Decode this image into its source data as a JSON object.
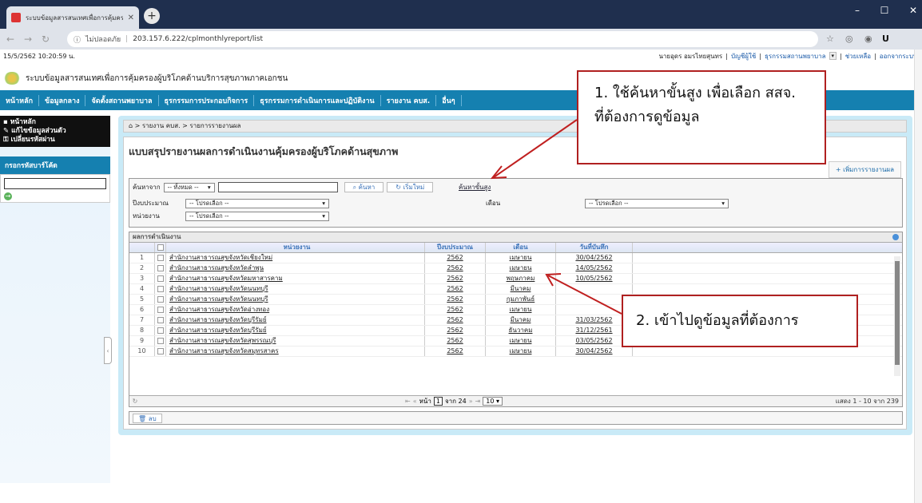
{
  "browser": {
    "tab_title": "ระบบข้อมูลสารสนเทศเพื่อการคุ้มครอง",
    "url_security": "ไม่ปลอดภัย",
    "url_host": "203.157.6.222",
    "url_path": "/cplmonthlyreport/list"
  },
  "header": {
    "datetime": "15/5/2562 10:20:59 น.",
    "user_name": "นายอุดร อมรไทยสุนทร",
    "account_link": "บัญชีผู้ใช้",
    "role_label": "ธุรกรรมสถานพยาบาล",
    "help": "ช่วยเหลือ",
    "logout": "ออกจากระบบ",
    "brand": "ระบบข้อมูลสารสนเทศเพื่อการคุ้มครองผู้บริโภคด้านบริการสุขภาพภาคเอกชน"
  },
  "menu": [
    "หน้าหลัก",
    "ข้อมูลกลาง",
    "จัดตั้งสถานพยาบาล",
    "ธุรกรรมการประกอบกิจการ",
    "ธุรกรรมการดำเนินการและปฏิบัติงาน",
    "รายงาน คบส.",
    "อื่นๆ"
  ],
  "sidebar": {
    "items": [
      "หน้าหลัก",
      "แก้ไขข้อมูลส่วนตัว",
      "เปลี่ยนรหัสผ่าน"
    ],
    "code_title": "กรอกรหัสบาร์โค้ด"
  },
  "breadcrumb": "รายงาน คบส. > รายการรายงานผล",
  "page_title": "แบบสรุปรายงานผลการดำเนินงานคุ้มครองผู้บริโภคด้านสุขภาพ",
  "add_button": "+ เพิ่มการรายงานผล",
  "search": {
    "from_label": "ค้นหาจาก",
    "from_value": "-- ทั้งหมด --",
    "search_btn": "ค้นหา",
    "reset_btn": "เริ่มใหม่",
    "advanced": "ค้นหาขั้นสูง",
    "year_label": "ปีงบประมาณ",
    "year_value": "-- โปรดเลือก --",
    "month_label": "เดือน",
    "month_value": "-- โปรดเลือก --",
    "unit_label": "หน่วยงาน",
    "unit_value": "-- โปรดเลือก --"
  },
  "results": {
    "title": "ผลการดำเนินงาน",
    "columns": [
      "หน่วยงาน",
      "ปีงบประมาณ",
      "เดือน",
      "วันที่บันทึก"
    ],
    "rows": [
      {
        "no": "1",
        "unit": "สำนักงานสาธารณสุขจังหวัดเชียงใหม่",
        "year": "2562",
        "month": "เมษายน",
        "date": "30/04/2562"
      },
      {
        "no": "2",
        "unit": "สำนักงานสาธารณสุขจังหวัดลำพูน",
        "year": "2562",
        "month": "เมษายน",
        "date": "14/05/2562"
      },
      {
        "no": "3",
        "unit": "สำนักงานสาธารณสุขจังหวัดมหาสารคาม",
        "year": "2562",
        "month": "พฤษภาคม",
        "date": "10/05/2562"
      },
      {
        "no": "4",
        "unit": "สำนักงานสาธารณสุขจังหวัดนนทบุรี",
        "year": "2562",
        "month": "มีนาคม",
        "date": ""
      },
      {
        "no": "5",
        "unit": "สำนักงานสาธารณสุขจังหวัดนนทบุรี",
        "year": "2562",
        "month": "กุมภาพันธ์",
        "date": ""
      },
      {
        "no": "6",
        "unit": "สำนักงานสาธารณสุขจังหวัดอ่างทอง",
        "year": "2562",
        "month": "เมษายน",
        "date": ""
      },
      {
        "no": "7",
        "unit": "สำนักงานสาธารณสุขจังหวัดบุรีรัมย์",
        "year": "2562",
        "month": "มีนาคม",
        "date": "31/03/2562"
      },
      {
        "no": "8",
        "unit": "สำนักงานสาธารณสุขจังหวัดบุรีรัมย์",
        "year": "2562",
        "month": "ธันวาคม",
        "date": "31/12/2561"
      },
      {
        "no": "9",
        "unit": "สำนักงานสาธารณสุขจังหวัดสุพรรณบุรี",
        "year": "2562",
        "month": "เมษายน",
        "date": "03/05/2562"
      },
      {
        "no": "10",
        "unit": "สำนักงานสาธารณสุขจังหวัดสมุทรสาคร",
        "year": "2562",
        "month": "เมษายน",
        "date": "30/04/2562"
      }
    ],
    "pager_page_label": "หน้า",
    "pager_page": "1",
    "pager_of": "จาก 24",
    "pager_size": "10",
    "pager_summary": "แสดง 1 - 10 จาก 239",
    "delete_btn": "ลบ"
  },
  "callouts": {
    "one": "1. ใช้ค้นหาขั้นสูง เพื่อเลือก สสจ. ที่ต้องการดูข้อมูล",
    "two": "2. เข้าไปดูข้อมูลที่ต้องการ"
  }
}
